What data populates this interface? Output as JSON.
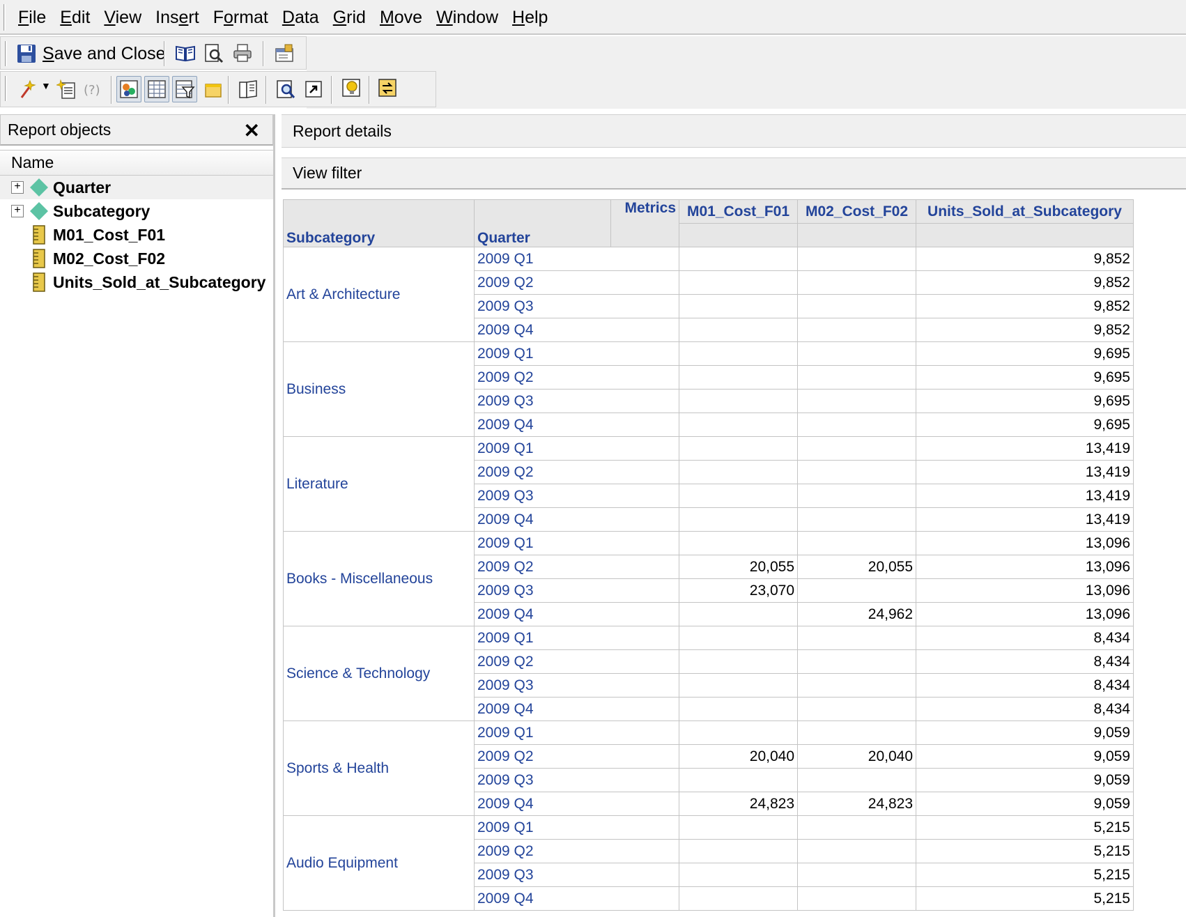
{
  "menu": [
    {
      "pre": "",
      "ul": "F",
      "post": "ile"
    },
    {
      "pre": "",
      "ul": "E",
      "post": "dit"
    },
    {
      "pre": "",
      "ul": "V",
      "post": "iew"
    },
    {
      "pre": "Ins",
      "ul": "e",
      "post": "rt"
    },
    {
      "pre": "F",
      "ul": "o",
      "post": "rmat"
    },
    {
      "pre": "",
      "ul": "D",
      "post": "ata"
    },
    {
      "pre": "",
      "ul": "G",
      "post": "rid"
    },
    {
      "pre": "",
      "ul": "M",
      "post": "ove"
    },
    {
      "pre": "",
      "ul": "W",
      "post": "indow"
    },
    {
      "pre": "",
      "ul": "H",
      "post": "elp"
    }
  ],
  "toolbar": {
    "save_ul": "S",
    "save_rest": "ave and Close"
  },
  "left_panel": {
    "title": "Report objects",
    "close": "✕",
    "column": "Name",
    "items": [
      {
        "label": "Quarter",
        "kind": "attribute",
        "expandable": "+"
      },
      {
        "label": "Subcategory",
        "kind": "attribute",
        "expandable": "+"
      },
      {
        "label": "M01_Cost_F01",
        "kind": "metric",
        "expandable": ""
      },
      {
        "label": "M02_Cost_F02",
        "kind": "metric",
        "expandable": ""
      },
      {
        "label": "Units_Sold_at_Subcategory",
        "kind": "metric",
        "expandable": ""
      }
    ]
  },
  "report_details": "Report details",
  "view_filter": "View filter",
  "grid": {
    "metrics_label": "Metrics",
    "row_headers": [
      "Subcategory",
      "Quarter"
    ],
    "columns": [
      "M01_Cost_F01",
      "M02_Cost_F02",
      "Units_Sold_at_Subcategory"
    ],
    "groups": [
      {
        "subcategory": "Art & Architecture",
        "rows": [
          {
            "q": "2009 Q1",
            "m1": "",
            "m2": "",
            "u": "9,852"
          },
          {
            "q": "2009 Q2",
            "m1": "",
            "m2": "",
            "u": "9,852"
          },
          {
            "q": "2009 Q3",
            "m1": "",
            "m2": "",
            "u": "9,852"
          },
          {
            "q": "2009 Q4",
            "m1": "",
            "m2": "",
            "u": "9,852"
          }
        ]
      },
      {
        "subcategory": "Business",
        "rows": [
          {
            "q": "2009 Q1",
            "m1": "",
            "m2": "",
            "u": "9,695"
          },
          {
            "q": "2009 Q2",
            "m1": "",
            "m2": "",
            "u": "9,695"
          },
          {
            "q": "2009 Q3",
            "m1": "",
            "m2": "",
            "u": "9,695"
          },
          {
            "q": "2009 Q4",
            "m1": "",
            "m2": "",
            "u": "9,695"
          }
        ]
      },
      {
        "subcategory": "Literature",
        "rows": [
          {
            "q": "2009 Q1",
            "m1": "",
            "m2": "",
            "u": "13,419"
          },
          {
            "q": "2009 Q2",
            "m1": "",
            "m2": "",
            "u": "13,419"
          },
          {
            "q": "2009 Q3",
            "m1": "",
            "m2": "",
            "u": "13,419"
          },
          {
            "q": "2009 Q4",
            "m1": "",
            "m2": "",
            "u": "13,419"
          }
        ]
      },
      {
        "subcategory": "Books - Miscellaneous",
        "rows": [
          {
            "q": "2009 Q1",
            "m1": "",
            "m2": "",
            "u": "13,096"
          },
          {
            "q": "2009 Q2",
            "m1": "20,055",
            "m2": "20,055",
            "u": "13,096"
          },
          {
            "q": "2009 Q3",
            "m1": "23,070",
            "m2": "",
            "u": "13,096"
          },
          {
            "q": "2009 Q4",
            "m1": "",
            "m2": "24,962",
            "u": "13,096"
          }
        ]
      },
      {
        "subcategory": "Science & Technology",
        "rows": [
          {
            "q": "2009 Q1",
            "m1": "",
            "m2": "",
            "u": "8,434"
          },
          {
            "q": "2009 Q2",
            "m1": "",
            "m2": "",
            "u": "8,434"
          },
          {
            "q": "2009 Q3",
            "m1": "",
            "m2": "",
            "u": "8,434"
          },
          {
            "q": "2009 Q4",
            "m1": "",
            "m2": "",
            "u": "8,434"
          }
        ]
      },
      {
        "subcategory": "Sports & Health",
        "rows": [
          {
            "q": "2009 Q1",
            "m1": "",
            "m2": "",
            "u": "9,059"
          },
          {
            "q": "2009 Q2",
            "m1": "20,040",
            "m2": "20,040",
            "u": "9,059"
          },
          {
            "q": "2009 Q3",
            "m1": "",
            "m2": "",
            "u": "9,059"
          },
          {
            "q": "2009 Q4",
            "m1": "24,823",
            "m2": "24,823",
            "u": "9,059"
          }
        ]
      },
      {
        "subcategory": "Audio Equipment",
        "rows": [
          {
            "q": "2009 Q1",
            "m1": "",
            "m2": "",
            "u": "5,215"
          },
          {
            "q": "2009 Q2",
            "m1": "",
            "m2": "",
            "u": "5,215"
          },
          {
            "q": "2009 Q3",
            "m1": "",
            "m2": "",
            "u": "5,215"
          },
          {
            "q": "2009 Q4",
            "m1": "",
            "m2": "",
            "u": "5,215"
          }
        ]
      }
    ]
  },
  "colors": {
    "header_text": "#23449a",
    "header_bg": "#e7e7e7",
    "panel_bg": "#f0f0f0",
    "attribute_icon": "#5cc3a4",
    "metric_icon": "#e8c84a"
  }
}
